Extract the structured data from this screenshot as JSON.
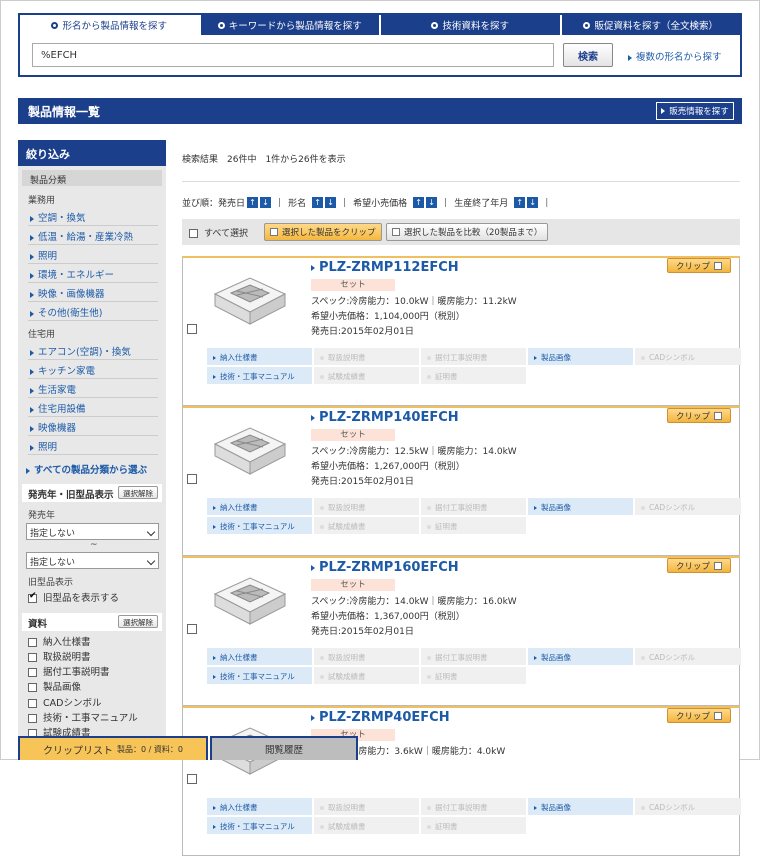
{
  "search": {
    "tabs": [
      "形名から製品情報を探す",
      "キーワードから製品情報を探す",
      "技術資料を探す",
      "販促資料を探す（全文検索）"
    ],
    "value": "%EFCH",
    "button": "検索",
    "multi_link": "複数の形名から探す"
  },
  "list_header": {
    "title": "製品情報一覧",
    "sales_button": "販売情報を探す"
  },
  "sidebar": {
    "title": "絞り込み",
    "category_title": "製品分類",
    "business_label": "業務用",
    "business_items": [
      "空調・換気",
      "低温・給湯・産業冷熱",
      "照明",
      "環境・エネルギー",
      "映像・画像機器",
      "その他(衛生他)"
    ],
    "home_label": "住宅用",
    "home_items": [
      "エアコン(空調)・換気",
      "キッチン家電",
      "生活家電",
      "住宅用設備",
      "映像機器",
      "照明"
    ],
    "all_link": "すべての製品分類から選ぶ",
    "release_section": "発売年・旧型品表示",
    "clear_label": "選択解除",
    "release_year_label": "発売年",
    "select_from": "指定しない",
    "tilde": "~",
    "select_to": "指定しない",
    "old_label": "旧型品表示",
    "old_checkbox": "旧型品を表示する",
    "docs_section": "資料",
    "doc_items": [
      "納入仕様書",
      "取扱説明書",
      "据付工事説明書",
      "製品画像",
      "CADシンボル",
      "技術・工事マニュアル",
      "試験成績書"
    ]
  },
  "results": {
    "count_text": "検索結果　26件中　1件から26件を表示",
    "sort_label": "並び順：発売日",
    "sort_items": [
      "形名",
      "希望小売価格",
      "生産終了年月"
    ],
    "select_all": "すべて選択",
    "clip_selected": "選択した製品をクリップ",
    "compare_selected": "選択した製品を比較（20製品まで）",
    "products": [
      {
        "name": "PLZ-ZRMP112EFCH",
        "badge": "セット",
        "spec": "スペック:冷房能力：10.0kW｜暖房能力：11.2kW",
        "price": "希望小売価格：1,104,000円（税別）",
        "date": "発売日:2015年02月01日"
      },
      {
        "name": "PLZ-ZRMP140EFCH",
        "badge": "セット",
        "spec": "スペック:冷房能力：12.5kW｜暖房能力：14.0kW",
        "price": "希望小売価格：1,267,000円（税別）",
        "date": "発売日:2015年02月01日"
      },
      {
        "name": "PLZ-ZRMP160EFCH",
        "badge": "セット",
        "spec": "スペック:冷房能力：14.0kW｜暖房能力：16.0kW",
        "price": "希望小売価格：1,367,000円（税別）",
        "date": "発売日:2015年02月01日"
      },
      {
        "name": "PLZ-ZRMP40EFCH",
        "badge": "セット",
        "spec": "スペック:冷房能力：3.6kW｜暖房能力：4.0kW",
        "price": "",
        "date": ""
      }
    ],
    "clip_label": "クリップ",
    "doc_labels": [
      "納入仕様書",
      "取扱説明書",
      "据付工事説明書",
      "製品画像",
      "CADシンボル",
      "技術・工事マニュアル",
      "試験成績書",
      "証明書"
    ]
  },
  "bottom": {
    "clip_list": "クリップリスト",
    "clip_counts": "製品：0 / 資料：0",
    "history": "閲覧履歴"
  }
}
